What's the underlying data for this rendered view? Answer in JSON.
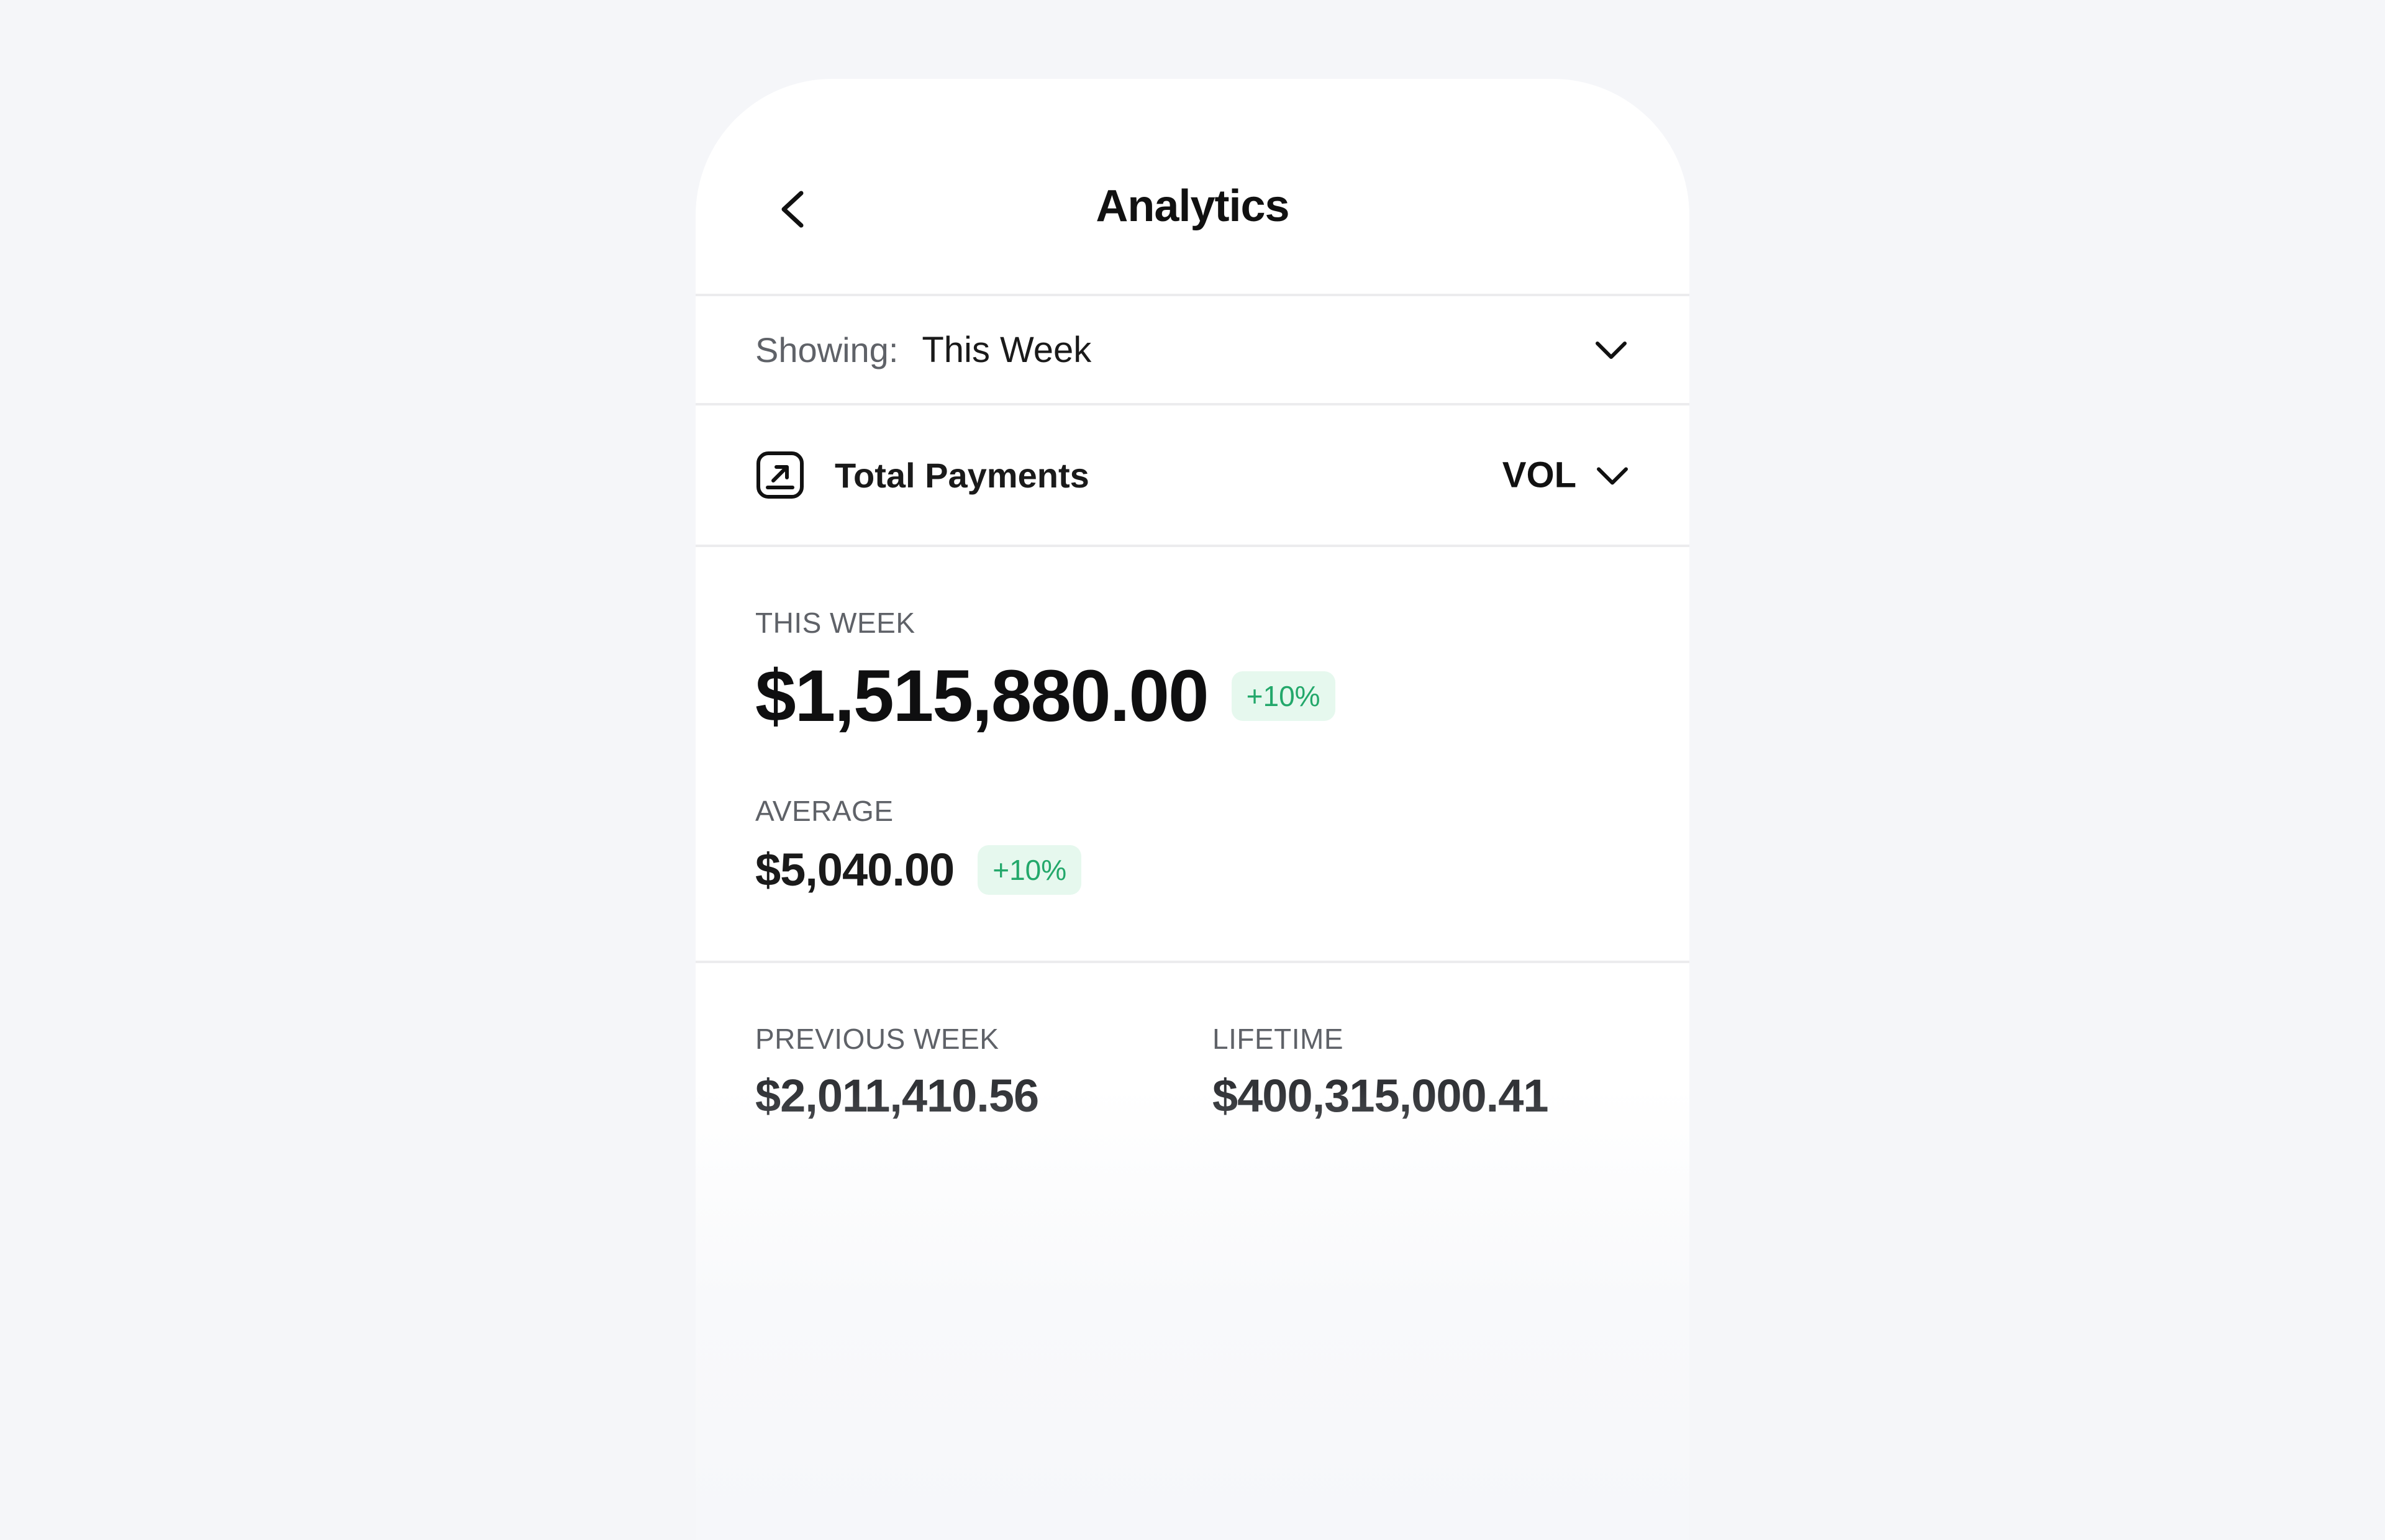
{
  "header": {
    "title": "Analytics",
    "back_icon": "chevron-left-icon"
  },
  "filter": {
    "label": "Showing:",
    "value": "This Week",
    "icon": "chevron-down-icon"
  },
  "metric": {
    "icon": "arrow-up-right-square-icon",
    "label": "Total Payments",
    "select_value": "VOL",
    "select_icon": "chevron-down-icon"
  },
  "stats": {
    "this_week": {
      "label": "THIS WEEK",
      "value": "$1,515,880.00",
      "change": "+10%"
    },
    "average": {
      "label": "AVERAGE",
      "value": "$5,040.00",
      "change": "+10%"
    }
  },
  "lower": {
    "previous_week": {
      "label": "PREVIOUS WEEK",
      "value": "$2,011,410.56"
    },
    "lifetime": {
      "label": "LIFETIME",
      "value": "$400,315,000.41"
    }
  },
  "colors": {
    "background": "#f5f6f9",
    "card": "#ffffff",
    "badge_bg": "#e6f8ee",
    "badge_text": "#23a86b",
    "muted_text": "#5f6268",
    "divider": "#ececee"
  }
}
